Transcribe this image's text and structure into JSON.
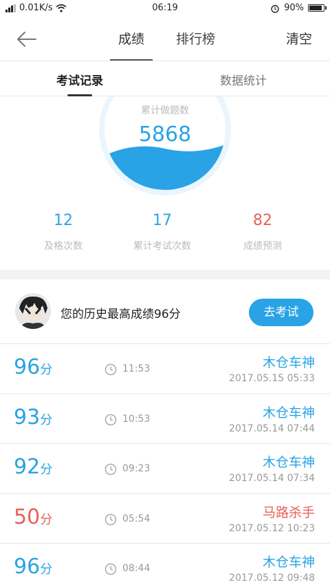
{
  "status_bar": {
    "network": "0.01K/s",
    "time": "06:19",
    "battery": "90%",
    "battery_level": 0.9
  },
  "header": {
    "tabs": [
      "成绩",
      "排行榜"
    ],
    "clear_label": "清空",
    "back_icon": "arrow-left-icon"
  },
  "subtabs": [
    "考试记录",
    "数据统计"
  ],
  "summary": {
    "caption": "累计做题数",
    "total_questions": "5868",
    "stats": [
      {
        "value": "12",
        "label": "及格次数"
      },
      {
        "value": "17",
        "label": "累计考试次数"
      },
      {
        "value": "82",
        "label": "成绩预测"
      }
    ]
  },
  "best": {
    "text": "您的历史最高成绩96分",
    "button": "去考试"
  },
  "records": [
    {
      "score": "96",
      "unit": "分",
      "duration": "11:53",
      "user": "木仓车神",
      "date": "2017.05.15   05:33",
      "low": false
    },
    {
      "score": "93",
      "unit": "分",
      "duration": "10:53",
      "user": "木仓车神",
      "date": "2017.05.14   07:44",
      "low": false
    },
    {
      "score": "92",
      "unit": "分",
      "duration": "09:23",
      "user": "木仓车神",
      "date": "2017.05.14   07:34",
      "low": false
    },
    {
      "score": "50",
      "unit": "分",
      "duration": "05:54",
      "user": "马路杀手",
      "date": "2017.05.12   10:23",
      "low": true
    },
    {
      "score": "96",
      "unit": "分",
      "duration": "08:44",
      "user": "木仓车神",
      "date": "2017.05.12   09:48",
      "low": false
    }
  ],
  "colors": {
    "accent": "#29a3e6",
    "warn": "#e86158"
  }
}
